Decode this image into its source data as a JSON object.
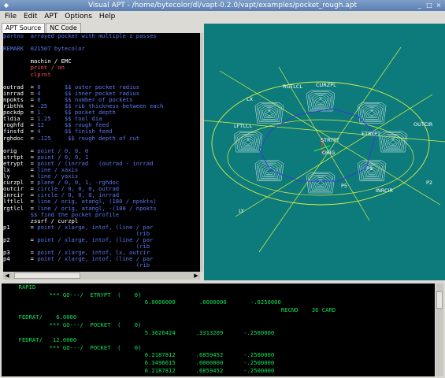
{
  "window": {
    "title": "Visual APT - /home/bytecolor/dl/vapt-0.2.0/vapt/examples/pocket_rough.apt"
  },
  "menu": [
    "File",
    "Edit",
    "APT",
    "Options",
    "Help"
  ],
  "tabs": [
    {
      "label": "APT Source",
      "active": true
    },
    {
      "label": "NC Code",
      "active": false
    }
  ],
  "source_lines": [
    [
      {
        "t": "partno  arrayed pocket with multiple z passes",
        "c": "#5a78f0"
      }
    ],
    [
      {
        "t": "",
        "c": "#ffffff"
      }
    ],
    [
      {
        "t": "REMARK  021507 bytecolor",
        "c": "#5a78f0"
      }
    ],
    [
      {
        "t": "",
        "c": "#ffffff"
      }
    ],
    [
      {
        "t": "        machin / EMC",
        "c": "#ffffff"
      }
    ],
    [
      {
        "t": "        print / on",
        "c": "#ff5555"
      }
    ],
    [
      {
        "t": "        clprnt",
        "c": "#ff5555"
      }
    ],
    [
      {
        "t": "",
        "c": "#ffffff"
      }
    ],
    [
      {
        "t": "outrad  = ",
        "c": "#ffffff"
      },
      {
        "t": "8       $$ outer pocket radius",
        "c": "#5a78f0"
      }
    ],
    [
      {
        "t": "inrrad  = ",
        "c": "#ffffff"
      },
      {
        "t": "4       $$ inner pocket radius",
        "c": "#5a78f0"
      }
    ],
    [
      {
        "t": "npokts  = ",
        "c": "#ffffff"
      },
      {
        "t": "8       $$ number of pockets",
        "c": "#5a78f0"
      }
    ],
    [
      {
        "t": "ribthk  = ",
        "c": "#ffffff"
      },
      {
        "t": ".25     $$ rib thickness between each",
        "c": "#5a78f0"
      }
    ],
    [
      {
        "t": "pockdp  = ",
        "c": "#ffffff"
      },
      {
        "t": "1.      $$ pocket depth",
        "c": "#5a78f0"
      }
    ],
    [
      {
        "t": "tldia   = ",
        "c": "#ffffff"
      },
      {
        "t": "1.25    $$ tool dia",
        "c": "#5a78f0"
      }
    ],
    [
      {
        "t": "roghfd  = ",
        "c": "#ffffff"
      },
      {
        "t": "12      $$ rough feed",
        "c": "#5a78f0"
      }
    ],
    [
      {
        "t": "finsfd  = ",
        "c": "#ffffff"
      },
      {
        "t": "4       $$ finish feed",
        "c": "#5a78f0"
      }
    ],
    [
      {
        "t": "rghdoc  = ",
        "c": "#ffffff"
      },
      {
        "t": ".125     $$ rough depth of cut",
        "c": "#5a78f0"
      }
    ],
    [
      {
        "t": "",
        "c": "#ffffff"
      }
    ],
    [
      {
        "t": "orig    = ",
        "c": "#ffffff"
      },
      {
        "t": "point / 0, 0, 0",
        "c": "#5a78f0"
      }
    ],
    [
      {
        "t": "strtpt  = ",
        "c": "#ffffff"
      },
      {
        "t": "point / 0, 0, 1",
        "c": "#5a78f0"
      }
    ],
    [
      {
        "t": "etrypt  = ",
        "c": "#ffffff"
      },
      {
        "t": "point / (inrrad   (outrad - inrrad",
        "c": "#5a78f0"
      }
    ],
    [
      {
        "t": "lx      = ",
        "c": "#ffffff"
      },
      {
        "t": "line / xaxis",
        "c": "#5a78f0"
      }
    ],
    [
      {
        "t": "ly      = ",
        "c": "#ffffff"
      },
      {
        "t": "line / yaxis",
        "c": "#5a78f0"
      }
    ],
    [
      {
        "t": "curzpl  = ",
        "c": "#ffffff"
      },
      {
        "t": "plane / 0, 0, 1, -rghdoc",
        "c": "#5a78f0"
      }
    ],
    [
      {
        "t": "outcir  = ",
        "c": "#ffffff"
      },
      {
        "t": "circle / 0, 0, 0, outrad",
        "c": "#5a78f0"
      }
    ],
    [
      {
        "t": "inrcir  = ",
        "c": "#ffffff"
      },
      {
        "t": "circle / 0, 0, 0, inrrad",
        "c": "#5a78f0"
      }
    ],
    [
      {
        "t": "lftlcl  = ",
        "c": "#ffffff"
      },
      {
        "t": "line / orig, atangl, (180 / npokts)",
        "c": "#5a78f0"
      }
    ],
    [
      {
        "t": "rgtlcl  = ",
        "c": "#ffffff"
      },
      {
        "t": "line / orig, atangl, -(180 / npokts",
        "c": "#5a78f0"
      }
    ],
    [
      {
        "t": "        $$ find the pocket profile",
        "c": "#5a78f0"
      }
    ],
    [
      {
        "t": "        zsurf / curzpl",
        "c": "#ffffff"
      }
    ],
    [
      {
        "t": "p1      = ",
        "c": "#ffffff"
      },
      {
        "t": "point / xlarge, intof, (line / par",
        "c": "#5a78f0"
      }
    ],
    [
      {
        "t": "                                       (rib",
        "c": "#5a78f0"
      }
    ],
    [
      {
        "t": "p2      = ",
        "c": "#ffffff"
      },
      {
        "t": "point / xlarge, intof, (line / par",
        "c": "#5a78f0"
      }
    ],
    [
      {
        "t": "                                       (rib",
        "c": "#5a78f0"
      }
    ],
    [
      {
        "t": "p3      = ",
        "c": "#ffffff"
      },
      {
        "t": "point / xlarge, intof, lx, outcir",
        "c": "#5a78f0"
      }
    ],
    [
      {
        "t": "p4      = ",
        "c": "#ffffff"
      },
      {
        "t": "point / xlarge, intof, (line / par",
        "c": "#5a78f0"
      }
    ],
    [
      {
        "t": "                                       (rib",
        "c": "#5a78f0"
      }
    ]
  ],
  "view_labels": {
    "rgtlcl": "RGTLCL",
    "curzpl": "CURZPL",
    "lx": "LX",
    "lftlcl": "LFTLCL",
    "outcir": "OUTCIR",
    "strtpt": "STRTPT",
    "orig": "ORIG",
    "etrypt": "ETRYPT",
    "p1": "P1",
    "p2": "P2",
    "p5": "P5",
    "ly": "LY",
    "inrcir": "INRCIR"
  },
  "console_lines": [
    "     RAPID",
    "              *** GO---/  ETRYPT  (    0)",
    "                                          6.0000000       .0000000       -.0250000",
    "                                                                                  RECNO    36 CARD",
    "     FEDRAT/    6.0000",
    "              *** GO---/  POCKET  (    0)",
    "                                          5.3626424      .3313209      -.2500000",
    "",
    "     FEDRAT/   12.0000",
    "              *** GO---/  POCKET  (    0)",
    "                                          6.2187812      .6859452      -.2500000",
    "                                          6.3496615      .0000000      -.2500000",
    "                                          6.2187812      .6859452      -.2500000"
  ],
  "colors": {
    "viewport_bg": "#0d7b7b",
    "console_text": "#14e35a",
    "editor_bg": "#000000",
    "keyword": "#5a78f0",
    "print": "#ff5555"
  }
}
